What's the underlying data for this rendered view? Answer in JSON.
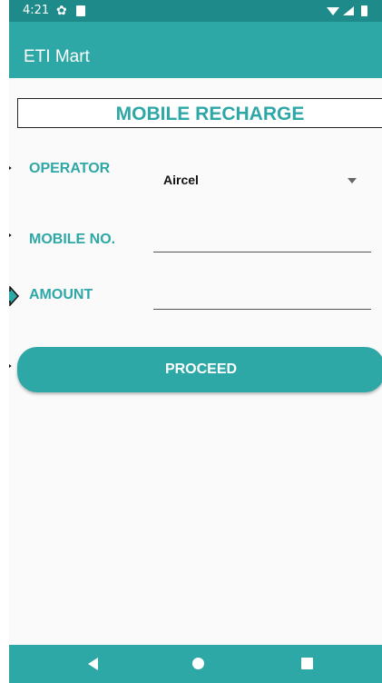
{
  "status": {
    "time": "4:21"
  },
  "app": {
    "title": "ETI Mart"
  },
  "screen": {
    "title": "MOBILE RECHARGE"
  },
  "form": {
    "operator_label": "OPERATOR",
    "operator_value": "Aircel",
    "mobile_label": "MOBILE NO.",
    "mobile_value": "",
    "amount_label": "AMOUNT",
    "amount_value": ""
  },
  "actions": {
    "proceed_label": "PROCEED"
  },
  "colors": {
    "accent": "#2ea7a7",
    "status_bar": "#1f8a8a",
    "background": "#fafafa"
  },
  "icons": {
    "status": [
      "gear-icon",
      "sd-card-icon",
      "wifi-icon",
      "signal-icon",
      "battery-icon"
    ],
    "nav": [
      "back-icon",
      "home-icon",
      "recents-icon"
    ],
    "pointers": [
      "arrow-right-icon"
    ]
  }
}
